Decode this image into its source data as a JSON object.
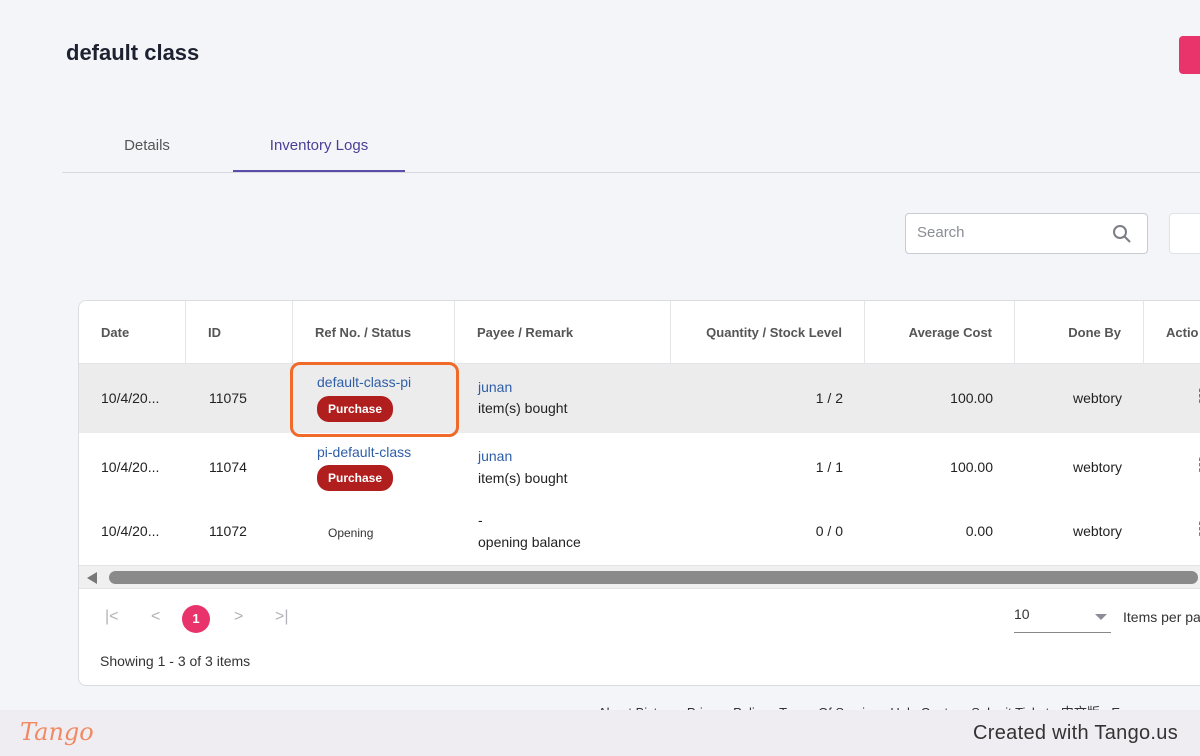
{
  "header": {
    "title": "default class"
  },
  "tabs": [
    {
      "label": "Details"
    },
    {
      "label": "Inventory Logs"
    }
  ],
  "search": {
    "placeholder": "Search"
  },
  "table": {
    "columns": [
      "Date",
      "ID",
      "Ref No. / Status",
      "Payee / Remark",
      "Quantity / Stock Level",
      "Average Cost",
      "Done By",
      "Actio"
    ],
    "rows": [
      {
        "date": "10/4/20...",
        "id": "11075",
        "ref": "default-class-pi",
        "status": "Purchase",
        "payee": "junan",
        "remark": "item(s) bought",
        "qty": "1 / 2",
        "cost": "100.00",
        "by": "webtory"
      },
      {
        "date": "10/4/20...",
        "id": "11074",
        "ref": "pi-default-class",
        "status": "Purchase",
        "payee": "junan",
        "remark": "item(s) bought",
        "qty": "1 / 1",
        "cost": "100.00",
        "by": "webtory"
      },
      {
        "date": "10/4/20...",
        "id": "11072",
        "ref": "",
        "status": "Opening",
        "payee": "-",
        "remark": "opening balance",
        "qty": "0 / 0",
        "cost": "0.00",
        "by": "webtory"
      }
    ]
  },
  "pagination": {
    "first": "|<",
    "prev": "<",
    "current": "1",
    "next": ">",
    "last": ">|",
    "per_page": "10",
    "per_page_label": "Items per pa",
    "showing": "Showing 1 - 3 of 3 items"
  },
  "footer": {
    "links": "About Biztory · Privacy Policy · Terms Of Service · Help Center · Submit Ticket · 中文版 · E"
  },
  "tango": {
    "logo": "Tango",
    "credit": "Created with Tango.us"
  },
  "colors": {
    "accent": "#e8336b",
    "tab_active": "#5b4ea8",
    "badge": "#b01e1e",
    "highlight": "#f06a2a",
    "link": "#2e5ea8"
  }
}
